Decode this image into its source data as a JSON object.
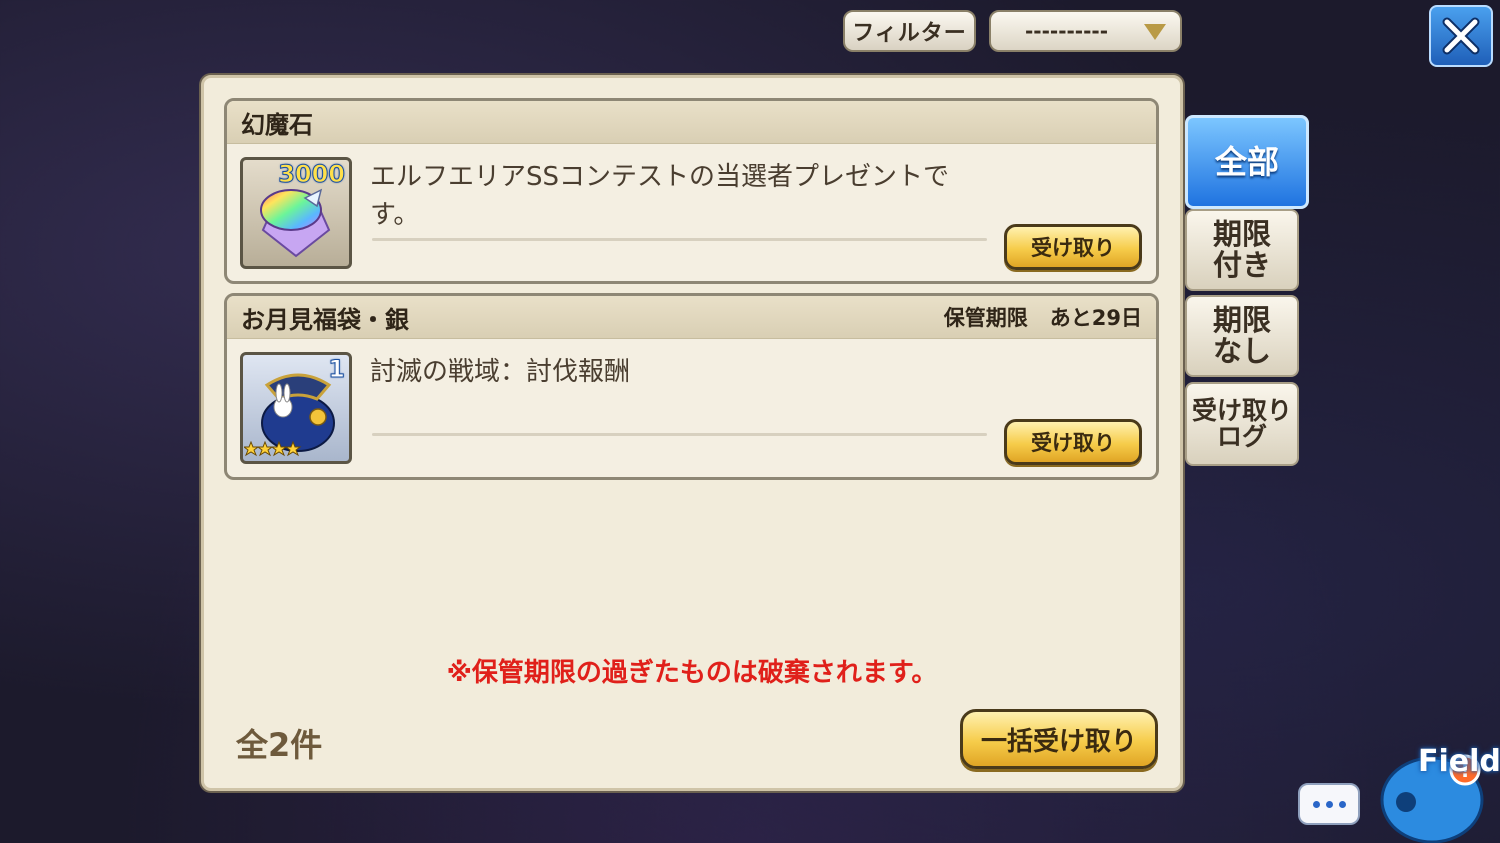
{
  "toolbar": {
    "filter_label": "フィルター",
    "select_value": "----------"
  },
  "presents": [
    {
      "title": "幻魔石",
      "expiry_label": "",
      "expiry_value": "",
      "icon": "rainbow-crystal-icon",
      "count": "3000",
      "description": "エルフエリアSSコンテストの当選者プレゼントです。",
      "claim_label": "受け取り"
    },
    {
      "title": "お月見福袋・銀",
      "expiry_label": "保管期限",
      "expiry_value": "あと29日",
      "icon": "lucky-bag-icon",
      "count": "1",
      "stars": 4,
      "description": "討滅の戦域：討伐報酬",
      "claim_label": "受け取り"
    }
  ],
  "notice": "※保管期限の過ぎたものは破棄されます。",
  "total": "全2件",
  "bulk_claim_label": "一括受け取り",
  "tabs": [
    {
      "label": "全部",
      "active": true
    },
    {
      "label": "期限\n付き",
      "active": false
    },
    {
      "label": "期限\nなし",
      "active": false
    },
    {
      "label": "受け取り\nログ",
      "active": false
    }
  ],
  "overlay": {
    "mascot_label": "Field"
  },
  "colors": {
    "accent_blue": "#1f73e0",
    "gold_button": "#f6cc4a",
    "notice_red": "#e0201a",
    "panel_bg": "#f2ecdb"
  }
}
